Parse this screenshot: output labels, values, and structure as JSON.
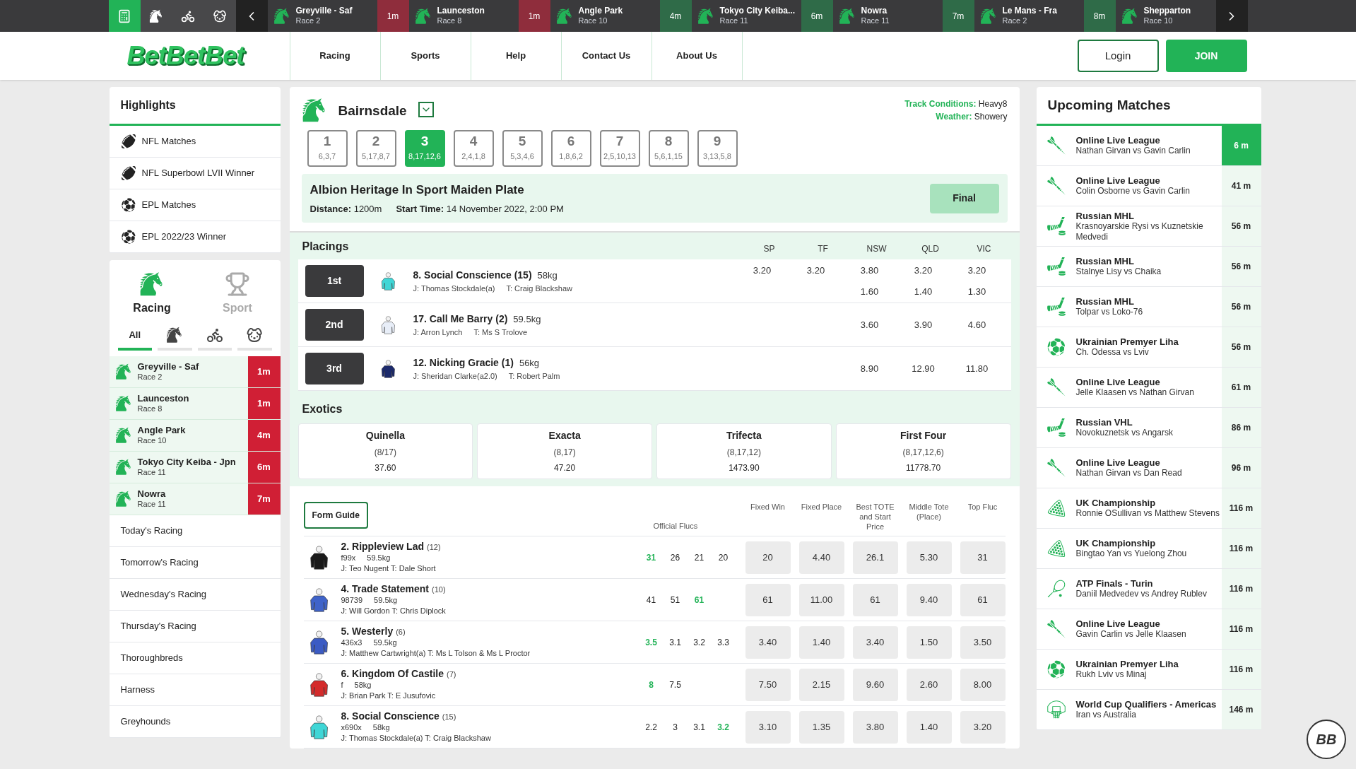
{
  "top_bar": {
    "quick_icons": [
      {
        "kind": "betslip",
        "selected": true
      },
      {
        "kind": "horse",
        "selected": false
      },
      {
        "kind": "harness",
        "selected": false
      },
      {
        "kind": "greyhound",
        "selected": false
      }
    ],
    "races": [
      {
        "name": "Greyville - Saf",
        "race": "Race 2",
        "time": "1m",
        "color": "#8f2d3c"
      },
      {
        "name": "Launceston",
        "race": "Race 8",
        "time": "1m",
        "color": "#8f2d3c"
      },
      {
        "name": "Angle Park",
        "race": "Race 10",
        "time": "4m",
        "color": "#2f6b48"
      },
      {
        "name": "Tokyo City Keiba...",
        "race": "Race 11",
        "time": "6m",
        "color": "#2f6b48"
      },
      {
        "name": "Nowra",
        "race": "Race 11",
        "time": "7m",
        "color": "#2f6b48"
      },
      {
        "name": "Le Mans - Fra",
        "race": "Race 2",
        "time": "8m",
        "color": "#2f6b48"
      },
      {
        "name": "Shepparton",
        "race": "Race 10"
      }
    ]
  },
  "header": {
    "logo": "BetBetBet",
    "nav": [
      "Racing",
      "Sports",
      "Help",
      "Contact Us",
      "About Us"
    ],
    "login": "Login",
    "join": "JOIN"
  },
  "highlights": {
    "title": "Highlights",
    "items": [
      {
        "kind": "football",
        "label": "NFL Matches"
      },
      {
        "kind": "football",
        "label": "NFL Superbowl LVII Winner"
      },
      {
        "kind": "soccer",
        "label": "EPL Matches"
      },
      {
        "kind": "soccer",
        "label": "EPL 2022/23 Winner"
      }
    ]
  },
  "sidebar": {
    "modes": [
      {
        "kind": "racing",
        "label": "Racing",
        "selected": true
      },
      {
        "kind": "sport",
        "label": "Sport",
        "selected": false
      }
    ],
    "filters": [
      {
        "kind": "all",
        "label": "All",
        "selected": true
      },
      {
        "kind": "horse",
        "selected": false
      },
      {
        "kind": "harness",
        "selected": false
      },
      {
        "kind": "greyhound",
        "selected": false
      }
    ],
    "races": [
      {
        "name": "Greyville - Saf",
        "race": "Race 2",
        "time": "1m"
      },
      {
        "name": "Launceston",
        "race": "Race 8",
        "time": "1m"
      },
      {
        "name": "Angle Park",
        "race": "Race 10",
        "time": "4m"
      },
      {
        "name": "Tokyo City Keiba - Jpn",
        "race": "Race 11",
        "time": "6m"
      },
      {
        "name": "Nowra",
        "race": "Race 11",
        "time": "7m"
      }
    ],
    "links": [
      "Today's Racing",
      "Tomorrow's Racing",
      "Wednesday's Racing",
      "Thursday's Racing",
      "Thoroughbreds",
      "Harness",
      "Greyhounds"
    ]
  },
  "race": {
    "meeting": "Bairnsdale",
    "track_label": "Track Conditions:",
    "track": "Heavy8",
    "weather_label": "Weather:",
    "weather": "Showery",
    "races": [
      {
        "number": "1",
        "result": "6,3,7",
        "selected": false
      },
      {
        "number": "2",
        "result": "5,17,8,7",
        "selected": false
      },
      {
        "number": "3",
        "result": "8,17,12,6",
        "selected": true
      },
      {
        "number": "4",
        "result": "2,4,1,8",
        "selected": false
      },
      {
        "number": "5",
        "result": "5,3,4,6",
        "selected": false
      },
      {
        "number": "6",
        "result": "1,8,6,2",
        "selected": false
      },
      {
        "number": "7",
        "result": "2,5,10,13",
        "selected": false
      },
      {
        "number": "8",
        "result": "5,6,1,15",
        "selected": false
      },
      {
        "number": "9",
        "result": "3,13,5,8",
        "selected": false
      }
    ],
    "title": "Albion Heritage In Sport Maiden Plate",
    "distance_label": "Distance:",
    "distance": "1200m",
    "start_label": "Start Time:",
    "start": "14 November 2022, 2:00 PM",
    "status": "Final"
  },
  "placings": {
    "title": "Placings",
    "columns": [
      "SP",
      "TF",
      "NSW",
      "QLD",
      "VIC"
    ],
    "rows": [
      {
        "place": "1st",
        "name": "8. Social Conscience (15)",
        "weight": "58kg",
        "jockey": "J: Thomas Stockdale(a)",
        "trainer": "T: Craig Blackshaw",
        "color": "#3fd6d6",
        "lines": [
          {
            "sp": "3.20",
            "tf": "3.20",
            "nsw": "3.80",
            "qld": "3.20",
            "vic": "3.20"
          },
          {
            "nsw": "1.60",
            "qld": "1.40",
            "vic": "1.30"
          }
        ]
      },
      {
        "place": "2nd",
        "name": "17. Call Me Barry (2)",
        "weight": "59.5kg",
        "jockey": "J: Arron Lynch",
        "trainer": "T: Ms S Trolove",
        "color": "#e8eef8",
        "lines": [
          {
            "nsw": "3.60",
            "qld": "3.90",
            "vic": "4.60"
          }
        ]
      },
      {
        "place": "3rd",
        "name": "12. Nicking Gracie (1)",
        "weight": "56kg",
        "jockey": "J: Sheridan Clarke(a2.0)",
        "trainer": "T: Robert Palm",
        "color": "#1c2a6b",
        "lines": [
          {
            "nsw": "8.90",
            "qld": "12.90",
            "vic": "11.80"
          }
        ]
      }
    ]
  },
  "exotics": {
    "title": "Exotics",
    "items": [
      {
        "name": "Quinella",
        "combo": "(8/17)",
        "dividend": "37.60"
      },
      {
        "name": "Exacta",
        "combo": "(8,17)",
        "dividend": "47.20"
      },
      {
        "name": "Trifecta",
        "combo": "(8,17,12)",
        "dividend": "1473.90"
      },
      {
        "name": "First Four",
        "combo": "(8,17,12,6)",
        "dividend": "11778.70"
      }
    ]
  },
  "form_guide": {
    "button": "Form Guide",
    "flucs_heading": "Official Flucs",
    "price_columns": [
      "Fixed Win",
      "Fixed Place",
      "Best TOTE and Start Price",
      "Middle Tote (Place)",
      "Top Fluc"
    ],
    "runners": [
      {
        "name": "2. Rippleview Lad",
        "barrier": "(12)",
        "form": "f99x",
        "weight": "59.5kg",
        "people": "J: Teo Nugent T: Dale Short",
        "color": "#1a1a1a",
        "flucs": [
          {
            "value": "31",
            "highlight": true
          },
          {
            "value": "26",
            "highlight": false
          },
          {
            "value": "21",
            "highlight": false
          },
          {
            "value": "20",
            "highlight": false
          }
        ],
        "prices": [
          "20",
          "4.40",
          "26.1",
          "5.30",
          "31"
        ]
      },
      {
        "name": "4. Trade Statement",
        "barrier": "(10)",
        "form": "98739",
        "weight": "59.5kg",
        "people": "J: Will Gordon T: Chris Diplock",
        "color": "#3f63c9",
        "flucs": [
          {
            "value": "41",
            "highlight": false
          },
          {
            "value": "51",
            "highlight": false
          },
          {
            "value": "61",
            "highlight": true
          }
        ],
        "prices": [
          "61",
          "11.00",
          "61",
          "9.40",
          "61"
        ]
      },
      {
        "name": "5. Westerly",
        "barrier": "(6)",
        "form": "436x3",
        "weight": "59.5kg",
        "people": "J: Matthew Cartwright(a) T: Ms L Tolson & Ms L Proctor",
        "color": "#3b5bc4",
        "flucs": [
          {
            "value": "3.5",
            "highlight": true
          },
          {
            "value": "3.1",
            "highlight": false
          },
          {
            "value": "3.2",
            "highlight": false
          },
          {
            "value": "3.3",
            "highlight": false
          }
        ],
        "prices": [
          "3.40",
          "1.40",
          "3.40",
          "1.50",
          "3.50"
        ]
      },
      {
        "name": "6. Kingdom Of Castile",
        "barrier": "(7)",
        "form": "f",
        "weight": "58kg",
        "people": "J: Brian Park T: E Jusufovic",
        "color": "#d42b2b",
        "flucs": [
          {
            "value": "8",
            "highlight": true
          },
          {
            "value": "7.5",
            "highlight": false
          }
        ],
        "prices": [
          "7.50",
          "2.15",
          "9.60",
          "2.60",
          "8.00"
        ]
      },
      {
        "name": "8. Social Conscience",
        "barrier": "(15)",
        "form": "x690x",
        "weight": "58kg",
        "people": "J: Thomas Stockdale(a) T: Craig Blackshaw",
        "color": "#3fd6d6",
        "flucs": [
          {
            "value": "2.2",
            "highlight": false
          },
          {
            "value": "3",
            "highlight": false
          },
          {
            "value": "3.1",
            "highlight": false
          },
          {
            "value": "3.2",
            "highlight": true
          }
        ],
        "prices": [
          "3.10",
          "1.35",
          "3.80",
          "1.40",
          "3.20"
        ]
      }
    ]
  },
  "upcoming": {
    "title": "Upcoming Matches",
    "matches": [
      {
        "kind": "darts",
        "league": "Online Live League",
        "teams": "Nathan Girvan vs Gavin Carlin",
        "time": "6 m",
        "selected": true
      },
      {
        "kind": "darts",
        "league": "Online Live League",
        "teams": "Colin Osborne vs Gavin Carlin",
        "time": "41 m",
        "selected": false
      },
      {
        "kind": "hockey",
        "league": "Russian MHL",
        "teams": "Krasnoyarskie Rysi vs Kuznetskie Medvedi",
        "time": "56 m",
        "selected": false
      },
      {
        "kind": "hockey",
        "league": "Russian MHL",
        "teams": "Stalnye Lisy vs Chaika",
        "time": "56 m",
        "selected": false
      },
      {
        "kind": "hockey",
        "league": "Russian MHL",
        "teams": "Tolpar vs Loko-76",
        "time": "56 m",
        "selected": false
      },
      {
        "kind": "soccer",
        "league": "Ukrainian Premyer Liha",
        "teams": "Ch. Odessa vs Lviv",
        "time": "56 m",
        "selected": false
      },
      {
        "kind": "darts",
        "league": "Online Live League",
        "teams": "Jelle Klaasen vs Nathan Girvan",
        "time": "61 m",
        "selected": false
      },
      {
        "kind": "hockey",
        "league": "Russian VHL",
        "teams": "Novokuznetsk vs Angarsk",
        "time": "86 m",
        "selected": false
      },
      {
        "kind": "darts",
        "league": "Online Live League",
        "teams": "Nathan Girvan vs Dan Read",
        "time": "96 m",
        "selected": false
      },
      {
        "kind": "snooker",
        "league": "UK Championship",
        "teams": "Ronnie OSullivan vs Matthew Stevens",
        "time": "116 m",
        "selected": false
      },
      {
        "kind": "snooker",
        "league": "UK Championship",
        "teams": "Bingtao Yan vs Yuelong Zhou",
        "time": "116 m",
        "selected": false
      },
      {
        "kind": "tennis",
        "league": "ATP Finals - Turin",
        "teams": "Daniil Medvedev vs Andrey Rublev",
        "time": "116 m",
        "selected": false
      },
      {
        "kind": "darts",
        "league": "Online Live League",
        "teams": "Gavin Carlin vs Jelle Klaasen",
        "time": "116 m",
        "selected": false
      },
      {
        "kind": "soccer",
        "league": "Ukrainian Premyer Liha",
        "teams": "Rukh Lviv vs Minaj",
        "time": "116 m",
        "selected": false
      },
      {
        "kind": "basketball",
        "league": "World Cup Qualifiers - Americas",
        "teams": "Iran vs Australia",
        "time": "146 m",
        "selected": false
      }
    ]
  },
  "chat_badge": "BB"
}
